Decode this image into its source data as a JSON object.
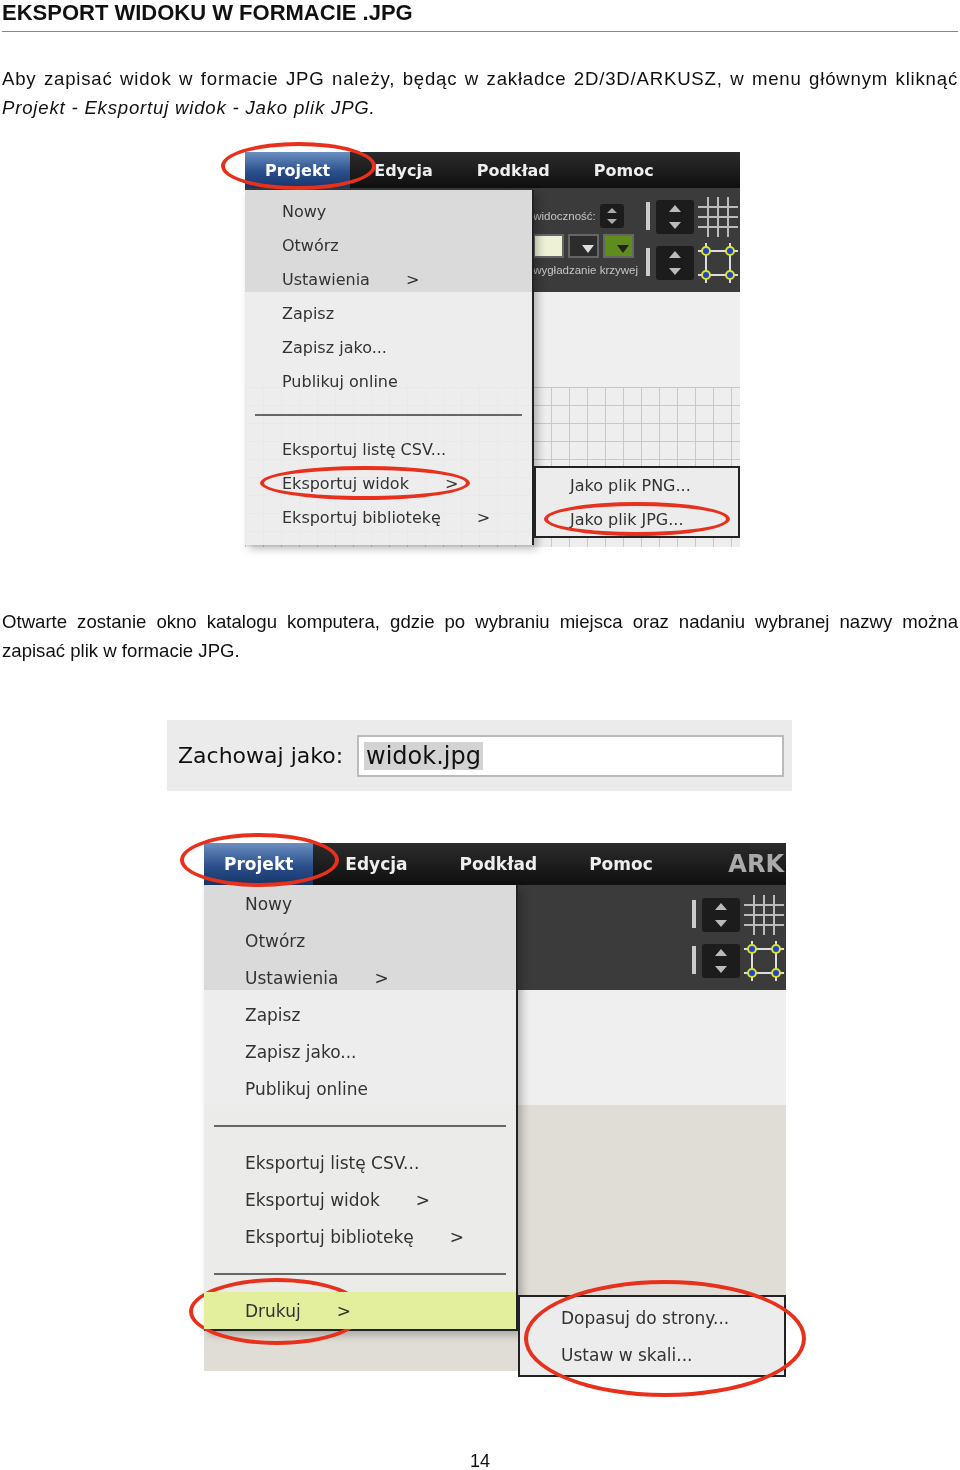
{
  "heading": "EKSPORT WIDOKU W FORMACIE .JPG",
  "intro": "Aby zapisać widok w formacie JPG należy, będąc w zakładce 2D/3D/ARKUSZ, w menu głównym kliknąć *Projekt - Eksportuj widok - Jako plik JPG.*",
  "screenshot_1": {
    "menubar": [
      {
        "label": "Projekt",
        "selected": true,
        "circled": true
      },
      {
        "label": "Edycja",
        "selected": false,
        "circled": false
      },
      {
        "label": "Podkład",
        "selected": false,
        "circled": false
      },
      {
        "label": "Pomoc",
        "selected": false,
        "circled": false
      }
    ],
    "toolbar": {
      "labels": [
        "widoczność:",
        "wygładzanie krzywej"
      ]
    },
    "menu": {
      "items": [
        {
          "kind": "item",
          "label": "Nowy",
          "selected": false,
          "circled": false
        },
        {
          "kind": "item",
          "label": "Otwórz",
          "selected": false,
          "circled": false
        },
        {
          "kind": "item",
          "label": "Ustawienia",
          "arrow": ">",
          "selected": false,
          "circled": false
        },
        {
          "kind": "item",
          "label": "Zapisz",
          "selected": false,
          "circled": false
        },
        {
          "kind": "item",
          "label": "Zapisz jako...",
          "selected": false,
          "circled": false
        },
        {
          "kind": "item",
          "label": "Publikuj online",
          "selected": false,
          "circled": false
        },
        {
          "kind": "separator"
        },
        {
          "kind": "item",
          "label": "Eksportuj listę CSV...",
          "selected": false,
          "circled": false
        },
        {
          "kind": "item",
          "label": "Eksportuj widok",
          "arrow": ">",
          "selected": false,
          "circled": true
        },
        {
          "kind": "item",
          "label": "Eksportuj bibliotekę",
          "arrow": ">",
          "selected": false,
          "circled": false
        }
      ]
    },
    "submenu": {
      "circled": false,
      "items": [
        {
          "label": "Jako plik PNG...",
          "selected": false,
          "circled": false
        },
        {
          "label": "Jako plik JPG...",
          "selected": false,
          "circled": true
        }
      ]
    }
  },
  "paragraph": "Otwarte zostanie okno katalogu komputera, gdzie po wybraniu miejsca oraz nadaniu wybranej nazwy można zapisać plik w formacie JPG.",
  "save_dialog": {
    "label": "Zachowaj jako:",
    "value": "widok.jpg",
    "value_selected": true
  },
  "screenshot_2": {
    "menubar": [
      {
        "label": "Projekt",
        "selected": true,
        "circled": true
      },
      {
        "label": "Edycja",
        "selected": false,
        "circled": false
      },
      {
        "label": "Podkład",
        "selected": false,
        "circled": false
      },
      {
        "label": "Pomoc",
        "selected": false,
        "circled": false
      }
    ],
    "mode_label": "ARK",
    "menu": {
      "items": [
        {
          "kind": "item",
          "label": "Nowy",
          "selected": false,
          "circled": false
        },
        {
          "kind": "item",
          "label": "Otwórz",
          "selected": false,
          "circled": false
        },
        {
          "kind": "item",
          "label": "Ustawienia",
          "arrow": ">",
          "selected": false,
          "circled": false
        },
        {
          "kind": "item",
          "label": "Zapisz",
          "selected": false,
          "circled": false
        },
        {
          "kind": "item",
          "label": "Zapisz jako...",
          "selected": false,
          "circled": false
        },
        {
          "kind": "item",
          "label": "Publikuj online",
          "selected": false,
          "circled": false
        },
        {
          "kind": "separator"
        },
        {
          "kind": "item",
          "label": "Eksportuj listę CSV...",
          "selected": false,
          "circled": false
        },
        {
          "kind": "item",
          "label": "Eksportuj widok",
          "arrow": ">",
          "selected": false,
          "circled": false
        },
        {
          "kind": "item",
          "label": "Eksportuj bibliotekę",
          "arrow": ">",
          "selected": false,
          "circled": false
        },
        {
          "kind": "separator"
        },
        {
          "kind": "item",
          "label": "Drukuj",
          "arrow": ">",
          "selected": true,
          "circled": true
        }
      ]
    },
    "submenu": {
      "circled": true,
      "items": [
        {
          "label": "Dopasuj do strony...",
          "selected": false,
          "circled": false
        },
        {
          "label": "Ustaw w skali...",
          "selected": false,
          "circled": false
        }
      ]
    }
  },
  "page_number": "14"
}
